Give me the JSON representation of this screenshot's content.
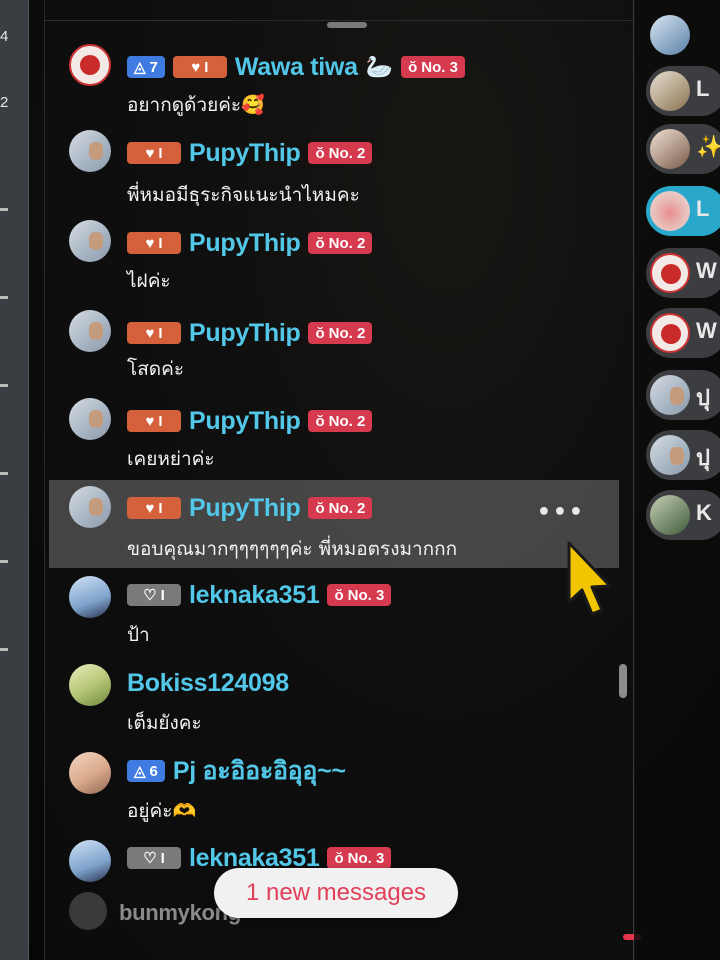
{
  "left_rail": {
    "numbers": [
      "4",
      "2"
    ]
  },
  "messages": [
    {
      "avatar": "tiktok-red-logo-avatar",
      "tier_badge": "7",
      "heart_badge": "I",
      "name": "Wawa tiwa",
      "name_emoji": "🦢",
      "rank": "No. 3",
      "text": "อยากดูด้วยค่ะ🥰",
      "highlighted": false
    },
    {
      "avatar": "user-photo-avatar",
      "heart_badge": "I",
      "name": "PupyThip",
      "rank": "No. 2",
      "text": "พี่หมอมีธุระกิจแนะนำไหมคะ",
      "highlighted": false
    },
    {
      "avatar": "user-photo-avatar",
      "heart_badge": "I",
      "name": "PupyThip",
      "rank": "No. 2",
      "text": "ไฝค่ะ",
      "highlighted": false
    },
    {
      "avatar": "user-photo-avatar",
      "heart_badge": "I",
      "name": "PupyThip",
      "rank": "No. 2",
      "text": "โสดค่ะ",
      "highlighted": false
    },
    {
      "avatar": "user-photo-avatar",
      "heart_badge": "I",
      "name": "PupyThip",
      "rank": "No. 2",
      "text": "เคยหย่าค่ะ",
      "highlighted": false
    },
    {
      "avatar": "user-photo-avatar",
      "heart_badge": "I",
      "name": "PupyThip",
      "rank": "No. 2",
      "text": "ขอบคุณมากๆๆๆๆๆๆค่ะ พี่หมอตรงมากกก",
      "highlighted": true,
      "more": "•••"
    },
    {
      "avatar": "user-photo-avatar",
      "heart_badge_gray": "I",
      "name": "leknaka351",
      "rank": "No. 3",
      "text": "ป้า",
      "highlighted": false
    },
    {
      "avatar": "user-photo-avatar",
      "name": "Bokiss124098",
      "text": "เต็มยังคะ",
      "highlighted": false
    },
    {
      "avatar": "user-photo-avatar",
      "tier_badge": "6",
      "name": "Pj อะอิอะอิอุอุ~~",
      "text": "อยู่ค่ะ🫶",
      "highlighted": false
    },
    {
      "avatar": "user-photo-avatar",
      "heart_badge_gray": "I",
      "name": "leknaka351",
      "rank": "No. 3",
      "text": "",
      "highlighted": false
    }
  ],
  "bottom_user": {
    "avatar": "bunny-avatar",
    "name": "bunmykong"
  },
  "new_messages_button": {
    "label": "1 new messages"
  },
  "right_list": {
    "items": [
      {
        "avatar": "user-photo-avatar",
        "text": ""
      },
      {
        "avatar": "user-photo-avatar",
        "text": "L"
      },
      {
        "avatar": "user-photo-avatar",
        "text": "✨"
      },
      {
        "avatar": "user-photo-avatar",
        "text": "L",
        "active": true
      },
      {
        "avatar": "tiktok-red-logo-avatar",
        "text": "W"
      },
      {
        "avatar": "tiktok-red-logo-avatar",
        "text": "W"
      },
      {
        "avatar": "user-photo-avatar",
        "text": "ปุ"
      },
      {
        "avatar": "user-photo-avatar",
        "text": "ปุ"
      },
      {
        "avatar": "user-photo-avatar",
        "text": "K"
      }
    ]
  },
  "colors": {
    "username": "#52c7e8",
    "rank_badge": "#d63a4f",
    "heart_badge": "#d4613b",
    "tier_badge": "#3f7be0",
    "new_messages_text": "#e0405a"
  }
}
